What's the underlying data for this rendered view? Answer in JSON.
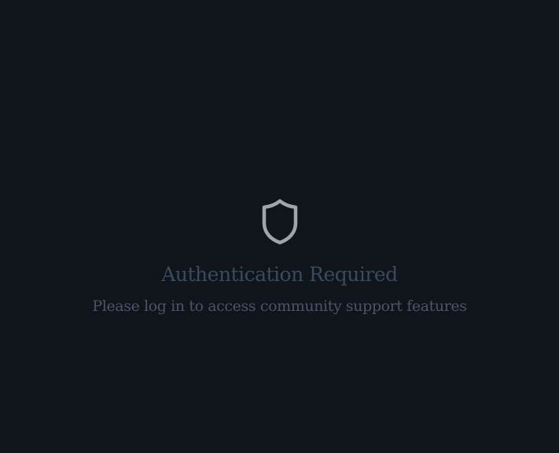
{
  "auth_gate": {
    "icon": "shield-icon",
    "title": "Authentication Required",
    "message": "Please log in to access community support features"
  },
  "colors": {
    "background": "#0f151a",
    "icon": "#a0a4ae",
    "title": "#3b4a5e",
    "message": "#4a5568"
  }
}
